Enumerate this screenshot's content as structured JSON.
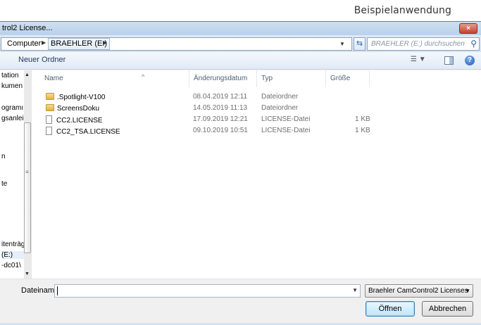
{
  "caption": "Beispielanwendung",
  "dialog": {
    "title": "trol2 License...",
    "close_label": "×"
  },
  "address": {
    "crumbs": [
      "Computer",
      "BRAEHLER (E:)"
    ],
    "search_placeholder": "BRAEHLER (E:) durchsuchen"
  },
  "toolbar": {
    "new_folder": "Neuer Ordner"
  },
  "nav": {
    "items": [
      "tation",
      "kumen",
      "ogramı",
      "gsanleit",
      "n",
      "te",
      "itenträg",
      "(E:)",
      "-dc01\\"
    ]
  },
  "columns": {
    "name": "Name",
    "date": "Änderungsdatum",
    "type": "Typ",
    "size": "Größe"
  },
  "files": [
    {
      "name": ".Spotlight-V100",
      "date": "08.04.2019 12:11",
      "type": "Dateiordner",
      "size": "",
      "kind": "folder"
    },
    {
      "name": "ScreensDoku",
      "date": "14.05.2019 11:13",
      "type": "Dateiordner",
      "size": "",
      "kind": "folder"
    },
    {
      "name": "CC2.LICENSE",
      "date": "17.09.2019 12:21",
      "type": "LICENSE-Datei",
      "size": "1 KB",
      "kind": "file"
    },
    {
      "name": "CC2_TSA.LICENSE",
      "date": "09.10.2019 10:51",
      "type": "LICENSE-Datei",
      "size": "1 KB",
      "kind": "file"
    }
  ],
  "bottom": {
    "filename_label": "Dateiname:",
    "filename_value": "",
    "filter": "Braehler CamControl2 Licenses",
    "open": "Öffnen",
    "cancel": "Abbrechen"
  }
}
